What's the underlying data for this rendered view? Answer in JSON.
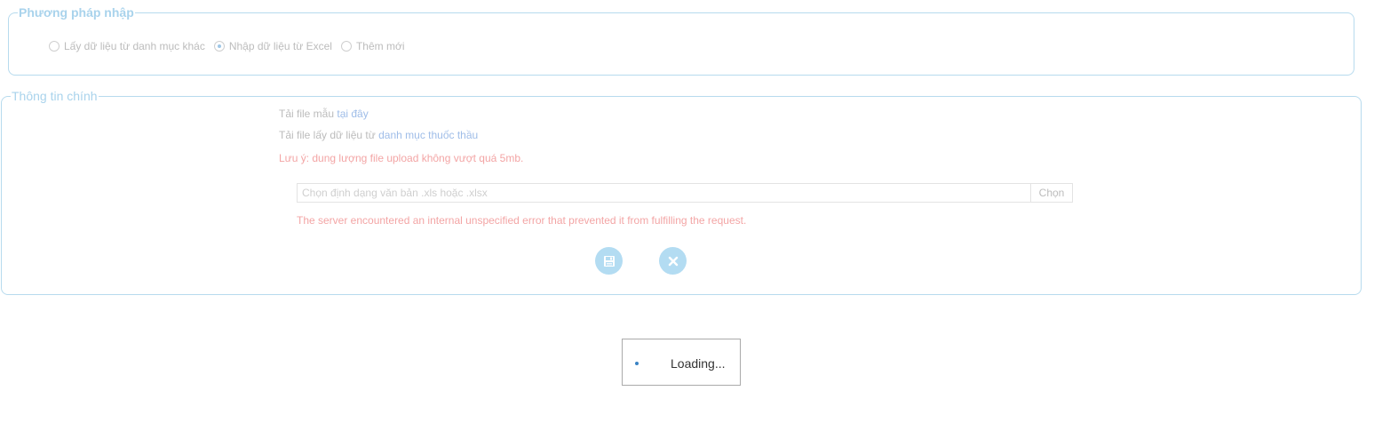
{
  "method_section": {
    "legend": "Phương pháp nhập",
    "options": [
      {
        "label": "Lấy dữ liệu từ danh mục khác",
        "checked": false
      },
      {
        "label": "Nhập dữ liệu từ Excel",
        "checked": true
      },
      {
        "label": "Thêm mới",
        "checked": false
      }
    ]
  },
  "main_section": {
    "legend": "Thông tin chính",
    "template_prefix": "Tải file mẫu",
    "template_link": "tại đây",
    "source_prefix": "Tải file lấy dữ liệu từ",
    "source_link": "danh mục thuốc thầu",
    "note": "Lưu ý: dung lượng file upload không vượt quá 5mb.",
    "file_placeholder": "Chọn định dạng văn bản .xls hoặc .xlsx",
    "file_button": "Chọn",
    "error": "The server encountered an internal unspecified error that prevented it from fulfilling the request.",
    "save_icon": "save-icon",
    "close_icon": "close-icon"
  },
  "loading": {
    "text": "Loading..."
  },
  "colors": {
    "border": "#b7dbee",
    "legend": "#a9d3ec",
    "link": "#9fbde8",
    "error": "#f3a5a5",
    "button": "#b3dcf2",
    "loading_dot": "#3a83c4"
  }
}
